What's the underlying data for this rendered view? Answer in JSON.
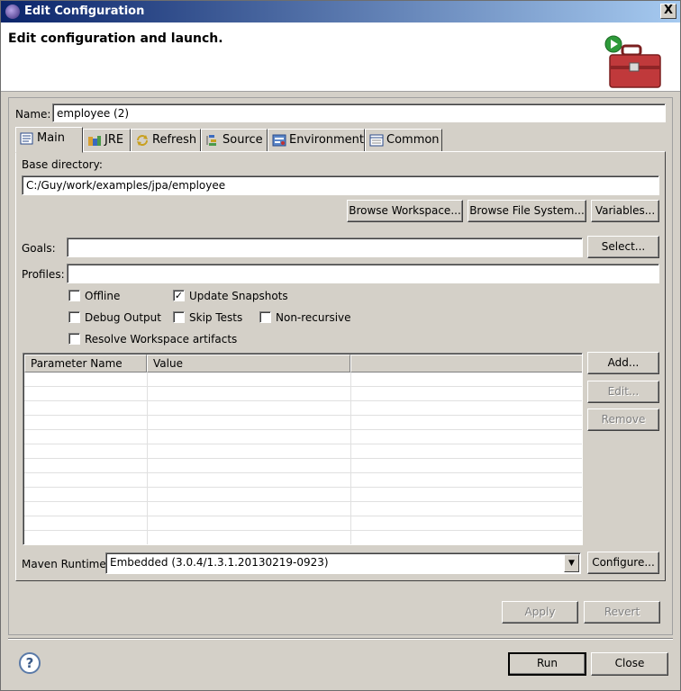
{
  "window": {
    "title": "Edit Configuration",
    "close_glyph": "X"
  },
  "header": {
    "heading": "Edit configuration and launch."
  },
  "name_field": {
    "label": "Name:",
    "value": "employee (2)"
  },
  "tabs": [
    {
      "label": "Main",
      "icon": "main-tab-icon",
      "active": true
    },
    {
      "label": "JRE",
      "icon": "jre-icon"
    },
    {
      "label": "Refresh",
      "icon": "refresh-icon"
    },
    {
      "label": "Source",
      "icon": "source-icon"
    },
    {
      "label": "Environment",
      "icon": "environment-icon"
    },
    {
      "label": "Common",
      "icon": "common-icon"
    }
  ],
  "main": {
    "base_dir_label": "Base directory:",
    "base_dir_value": "C:/Guy/work/examples/jpa/employee",
    "browse_workspace": "Browse Workspace...",
    "browse_fs": "Browse File System...",
    "variables": "Variables...",
    "goals_label": "Goals:",
    "goals_value": "",
    "select_btn": "Select...",
    "profiles_label": "Profiles:",
    "profiles_value": "",
    "checkboxes": {
      "offline": {
        "label": "Offline",
        "checked": false
      },
      "update_snapshots": {
        "label": "Update Snapshots",
        "checked": true
      },
      "debug_output": {
        "label": "Debug Output",
        "checked": false
      },
      "skip_tests": {
        "label": "Skip Tests",
        "checked": false
      },
      "non_recursive": {
        "label": "Non-recursive",
        "checked": false
      },
      "resolve_workspace": {
        "label": "Resolve Workspace artifacts",
        "checked": false
      }
    },
    "table": {
      "col_name": "Parameter Name",
      "col_value": "Value"
    },
    "add_btn": "Add...",
    "edit_btn": "Edit...",
    "remove_btn": "Remove",
    "runtime_label": "Maven Runtime:",
    "runtime_value": "Embedded (3.0.4/1.3.1.20130219-0923)",
    "configure_btn": "Configure..."
  },
  "apply_btn": "Apply",
  "revert_btn": "Revert",
  "help_glyph": "?",
  "run_btn": "Run",
  "close_btn": "Close",
  "check_glyph": "✓",
  "dropdown_glyph": "▼"
}
